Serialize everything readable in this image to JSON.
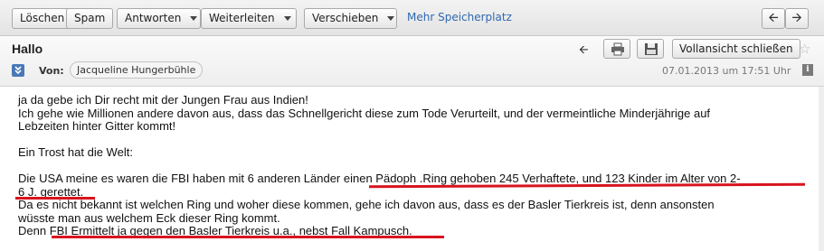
{
  "toolbar": {
    "delete_label": "Löschen",
    "spam_label": "Spam",
    "reply_label": "Antworten",
    "forward_label": "Weiterleiten",
    "move_label": "Verschieben",
    "more_storage_label": "Mehr Speicherplatz",
    "prev_icon": "arrow-left",
    "next_icon": "arrow-right"
  },
  "message": {
    "subject": "Hallo",
    "from_label": "Von:",
    "sender": "Jacqueline Hungerbühle",
    "date": "07.01.2013 um 17:51 Uhr",
    "fullview_label": "Vollansicht schließen",
    "info_label": "i",
    "body": {
      "l1": "ja da gebe ich Dir recht mit der Jungen Frau aus Indien!",
      "l2": "Ich gehe wie Millionen andere davon aus, dass das Schnellgericht diese zum Tode Verurteilt, und der vermeintliche Minderjährige auf",
      "l3": "Lebzeiten hinter Gitter kommt!",
      "l4": "Ein Trost hat die Welt:",
      "l5": "Die USA meine es waren die FBI haben mit 6 anderen Länder einen Pädoph .Ring gehoben 245 Verhaftete, und 123 Kinder im Alter von 2-",
      "l6": "6 J. gerettet.",
      "l7": "Da es nicht bekannt ist welchen Ring und woher diese kommen, gehe ich davon aus, dass es der Basler Tierkreis ist, denn ansonsten",
      "l8": "wüsste man aus welchem Eck dieser Ring kommt.",
      "l9": "Denn FBI Ermittelt ja gegen den Basler Tierkreis u.a., nebst Fall Kampusch."
    }
  },
  "colors": {
    "link": "#2f68b1",
    "highlight": "#d8141f",
    "expand_icon": "#4a78b7"
  }
}
